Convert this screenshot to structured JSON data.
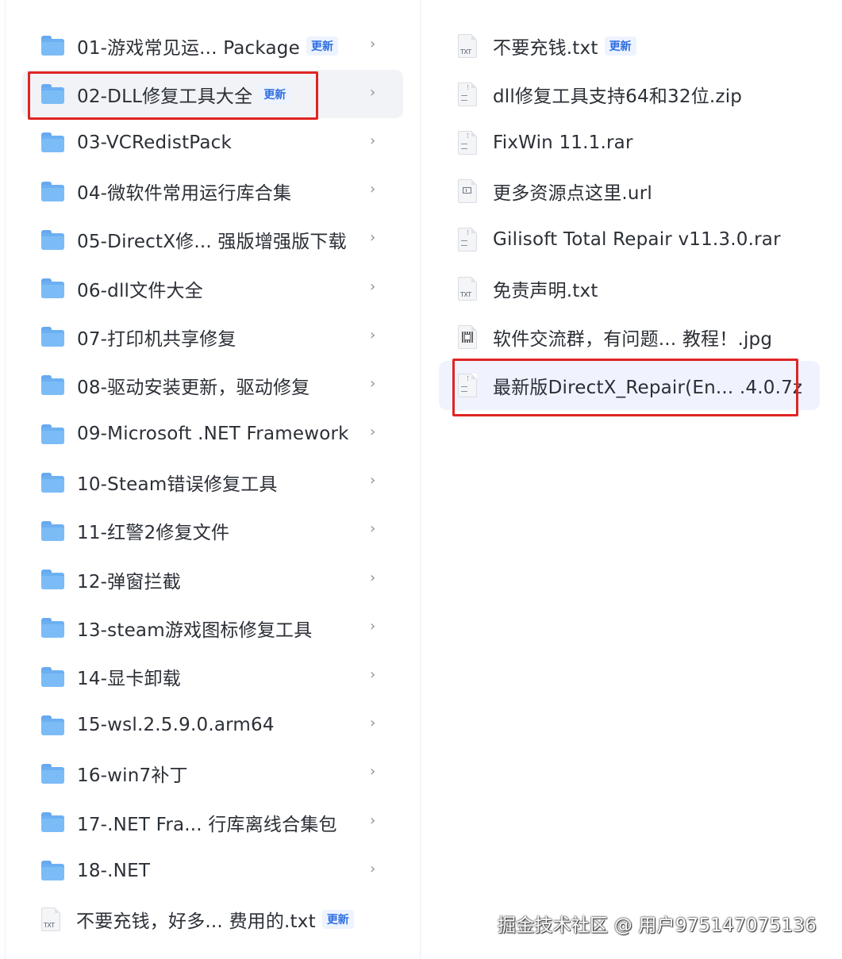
{
  "left_items": [
    {
      "name": "01-游戏常见运...  Package",
      "type": "folder",
      "badge": "更新"
    },
    {
      "name": "02-DLL修复工具大全",
      "type": "folder",
      "badge": "更新"
    },
    {
      "name": "03-VCRedistPack",
      "type": "folder"
    },
    {
      "name": "04-微软件常用运行库合集",
      "type": "folder"
    },
    {
      "name": "05-DirectX修... 强版增强版下载",
      "type": "folder"
    },
    {
      "name": "06-dll文件大全",
      "type": "folder"
    },
    {
      "name": "07-打印机共享修复",
      "type": "folder"
    },
    {
      "name": "08-驱动安装更新，驱动修复",
      "type": "folder"
    },
    {
      "name": "09-Microsoft .NET Framework",
      "type": "folder"
    },
    {
      "name": "10-Steam错误修复工具",
      "type": "folder"
    },
    {
      "name": "11-红警2修复文件",
      "type": "folder"
    },
    {
      "name": "12-弹窗拦截",
      "type": "folder"
    },
    {
      "name": "13-steam游戏图标修复工具",
      "type": "folder"
    },
    {
      "name": "14-显卡卸载",
      "type": "folder"
    },
    {
      "name": "15-wsl.2.5.9.0.arm64",
      "type": "folder"
    },
    {
      "name": "16-win7补丁",
      "type": "folder"
    },
    {
      "name": "17-.NET Fra...   行库离线合集包",
      "type": "folder"
    },
    {
      "name": "18-.NET",
      "type": "folder"
    },
    {
      "name": "不要充钱，好多...  费用的.txt",
      "type": "txt",
      "badge": "更新"
    }
  ],
  "right_items": [
    {
      "name": "不要充钱.txt",
      "type": "txt",
      "badge": "更新"
    },
    {
      "name": "dll修复工具支持64和32位.zip",
      "type": "zip"
    },
    {
      "name": "FixWin 11.1.rar",
      "type": "zip"
    },
    {
      "name": "更多资源点这里.url",
      "type": "url"
    },
    {
      "name": "Gilisoft Total Repair v11.3.0.rar",
      "type": "zip"
    },
    {
      "name": "免责声明.txt",
      "type": "txt"
    },
    {
      "name": "软件交流群，有问题...  教程！.jpg",
      "type": "jpg"
    },
    {
      "name": "最新版DirectX_Repair(En... .4.0.7z",
      "type": "zip"
    }
  ],
  "watermark": "掘金技术社区 @ 用户975147075136",
  "colors": {
    "highlight": "#e02424",
    "badge": "#2f6fe0",
    "folder": "#6cb0f2"
  },
  "icons": {
    "folder": "folder-icon",
    "txt": "txt-file-icon",
    "zip": "archive-file-icon",
    "url": "url-file-icon",
    "jpg": "image-file-icon",
    "chevron": "chevron-right-icon"
  }
}
